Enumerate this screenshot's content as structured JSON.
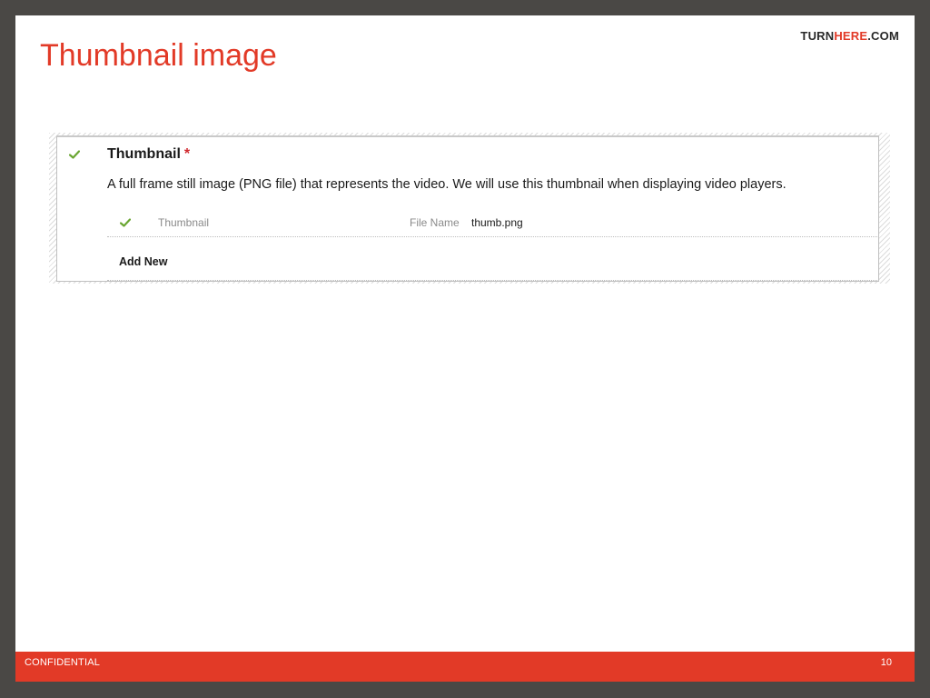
{
  "slide": {
    "title": "Thumbnail image",
    "brand": {
      "prefix": "TURN",
      "accent": "HERE",
      "suffix": ".COM"
    }
  },
  "panel": {
    "section_title": "Thumbnail",
    "required_marker": "*",
    "description": "A full frame still image (PNG file) that represents the video. We will use this thumbnail when displaying video players.",
    "items": [
      {
        "status_icon": "check-icon",
        "label": "Thumbnail",
        "field_label": "File Name",
        "field_value": "thumb.png"
      }
    ],
    "add_new_label": "Add New"
  },
  "footer": {
    "left_text": "CONFIDENTIAL",
    "page_number": "10"
  },
  "colors": {
    "accent": "#e23a27",
    "frame": "#4a4845",
    "check": "#6aa632",
    "required": "#d0282e"
  }
}
